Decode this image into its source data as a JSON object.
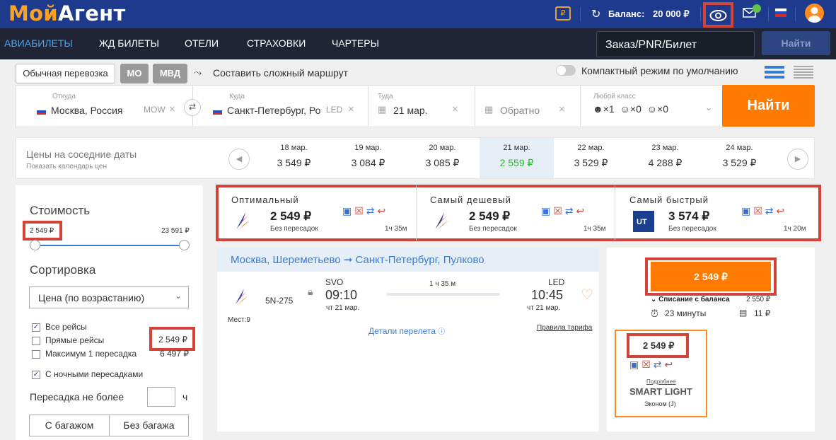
{
  "header": {
    "logo_part1": "Мой",
    "logo_part2": "Агент",
    "balance_label": "Баланс:",
    "balance_value": "20 000 ₽"
  },
  "nav": {
    "items": [
      "АВИАБИЛЕТЫ",
      "ЖД БИЛЕТЫ",
      "ОТЕЛИ",
      "СТРАХОВКИ",
      "ЧАРТЕРЫ"
    ],
    "pnr_placeholder": "Заказ/PNR/Билет",
    "pnr_button": "Найти"
  },
  "options": {
    "regular": "Обычная перевозка",
    "mo": "МО",
    "mvd": "МВД",
    "complex_route": "Составить сложный маршрут",
    "compact_mode": "Компактный режим по умолчанию"
  },
  "form": {
    "from_label": "Откуда",
    "from_value": "Москва, Россия",
    "from_code": "MOW",
    "to_label": "Куда",
    "to_value": "Санкт-Петербург, Ро",
    "to_code": "LED",
    "there_label": "Туда",
    "there_value": "21 мар.",
    "back_value": "Обратно",
    "class_label": "Любой класс",
    "pax_adults": "×1",
    "pax_children": "×0",
    "pax_infants": "×0",
    "search_button": "Найти"
  },
  "dates": {
    "title": "Цены на соседние даты",
    "subtitle": "Показать календарь цен",
    "items": [
      {
        "date": "18 мар.",
        "price": "3 549 ₽"
      },
      {
        "date": "19 мар.",
        "price": "3 084 ₽"
      },
      {
        "date": "20 мар.",
        "price": "3 085 ₽"
      },
      {
        "date": "21 мар.",
        "price": "2 559 ₽"
      },
      {
        "date": "22 мар.",
        "price": "3 529 ₽"
      },
      {
        "date": "23 мар.",
        "price": "4 288 ₽"
      },
      {
        "date": "24 мар.",
        "price": "3 529 ₽"
      }
    ],
    "selected_index": 3,
    "selected_color": "#2eb82e"
  },
  "filters": {
    "cost_title": "Стоимость",
    "price_min": "2 549 ₽",
    "price_max": "23 591 ₽",
    "sort_title": "Сортировка",
    "sort_value": "Цена (по возрастанию)",
    "all_flights": "Все рейсы",
    "direct_flights": "Прямые рейсы",
    "direct_price": "2 549 ₽",
    "max_one_stop": "Максимум 1 пересадка",
    "max_one_stop_price": "6 497 ₽",
    "night_stops": "С ночными пересадками",
    "stop_limit": "Пересадка не более",
    "stop_limit_unit": "ч",
    "with_baggage": "С багажом",
    "no_baggage": "Без багажа"
  },
  "summary": [
    {
      "title": "Оптимальный",
      "price": "2 549 ₽",
      "stops": "Без пересадок",
      "duration": "1ч 35м"
    },
    {
      "title": "Самый дешевый",
      "price": "2 549 ₽",
      "stops": "Без пересадок",
      "duration": "1ч 35м"
    },
    {
      "title": "Самый быстрый",
      "price": "3 574 ₽",
      "stops": "Без пересадок",
      "duration": "1ч 20м"
    }
  ],
  "flight": {
    "route": "Москва, Шереметьево ➞ Санкт-Петербург, Пулково",
    "number": "5N-275",
    "seats": "Мест:9",
    "dep_code": "SVO",
    "dep_time": "09:10",
    "dep_date": "чт 21 мар.",
    "duration": "1 ч 35 м",
    "arr_code": "LED",
    "arr_time": "10:45",
    "arr_date": "чт 21 мар.",
    "details": "Детали перелета",
    "tariff_rules": "Правила тарифа"
  },
  "offer": {
    "button_price": "2 549 ₽",
    "balance_debit_label": "Списание с баланса",
    "balance_debit_value": "2 550 ₽",
    "time": "23 минуты",
    "fee": "11 ₽",
    "fare_price": "2 549 ₽",
    "more": "Подробнее",
    "fare_name": "SMART LIGHT",
    "fare_class": "Эконом (J)"
  },
  "colors": {
    "header_bg": "#1d3a8c",
    "nav_bg": "#1f2534",
    "accent": "#ff7a00",
    "highlight_box": "#d0443a",
    "link": "#3a7bd5"
  }
}
